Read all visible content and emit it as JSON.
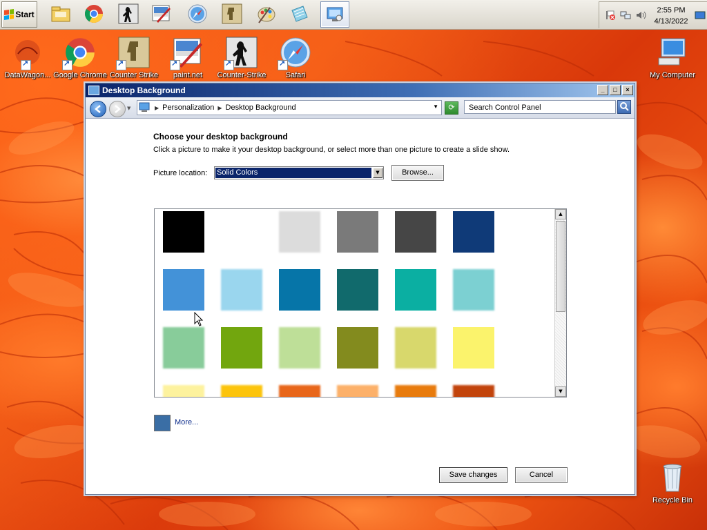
{
  "taskbar": {
    "start_label": "Start",
    "clock": {
      "time": "2:55 PM",
      "date": "4/13/2022"
    }
  },
  "desktop_icons": [
    {
      "label": "DataWagon..."
    },
    {
      "label": "Google Chrome"
    },
    {
      "label": "Counter Strike"
    },
    {
      "label": "paint.net"
    },
    {
      "label": "Counter-Strike"
    },
    {
      "label": "Safari"
    },
    {
      "label": "My Computer"
    },
    {
      "label": "Recycle Bin"
    }
  ],
  "window": {
    "title": "Desktop Background",
    "address": {
      "crumbs": [
        "Personalization",
        "Desktop Background"
      ]
    },
    "search_placeholder": "Search Control Panel",
    "heading": "Choose your desktop background",
    "description": "Click a picture to make it your desktop background, or select more than one picture to create a slide show.",
    "location_label": "Picture location:",
    "location_value": "Solid Colors",
    "browse_label": "Browse...",
    "more_label": "More...",
    "save_label": "Save changes",
    "cancel_label": "Cancel"
  },
  "swatches": [
    [
      "#000000",
      "#ffffff",
      "#dcdcdc",
      "#7a7a7a",
      "#464646",
      "#0f3a78"
    ],
    [
      "#4392d8",
      "#9ad6ee",
      "#0675a8",
      "#116a6c",
      "#0bafa2",
      "#7cd0d2"
    ],
    [
      "#88cc9a",
      "#72a60e",
      "#bedf98",
      "#838b1e",
      "#d8d86c",
      "#fbf36c"
    ],
    [
      "#fdf29e",
      "#fcc40c",
      "#e8661a",
      "#fcb069",
      "#e87b0d",
      "#c2440c"
    ]
  ]
}
